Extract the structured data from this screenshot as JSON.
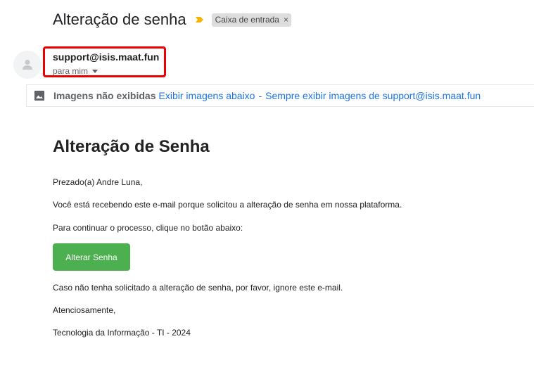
{
  "email": {
    "subject": "Alteração de senha",
    "label_chip": "Caixa de entrada",
    "label_chip_close": "×",
    "sender_email": "support@isis.maat.fun",
    "recipient": "para mim"
  },
  "images_notice": {
    "message": "Imagens não exibidas",
    "show_below_link": "Exibir imagens abaixo",
    "separator": "-",
    "always_show_link": "Sempre exibir imagens de support@isis.maat.fun"
  },
  "body": {
    "title": "Alteração de Senha",
    "greeting": "Prezado(a) Andre Luna,",
    "line1": "Você está recebendo este e-mail porque solicitou a alteração de senha em nossa plataforma.",
    "line2": "Para continuar o processo, clique no botão abaixo:",
    "button_label": "Alterar Senha",
    "line3": "Caso não tenha solicitado a alteração de senha, por favor, ignore este e-mail.",
    "closing": "Atenciosamente,",
    "signature": "Tecnologia da Informação - TI - 2024"
  },
  "colors": {
    "highlight_box": "#ea0000",
    "link": "#1a73e8",
    "button": "#4caf50",
    "importance_marker": "#f4b400"
  },
  "icons": {
    "importance": "importance-marker-icon",
    "avatar": "person-avatar-icon",
    "images": "image-icon",
    "recipient_details": "caret-down-icon"
  }
}
